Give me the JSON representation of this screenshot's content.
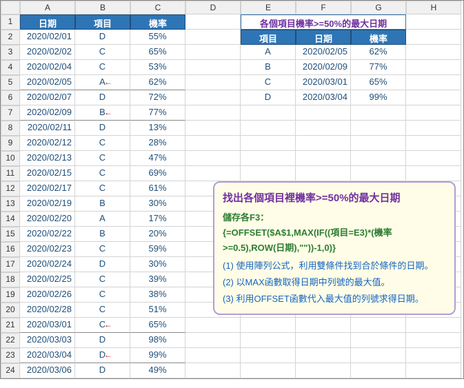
{
  "columns": [
    "A",
    "B",
    "C",
    "D",
    "E",
    "F",
    "G",
    "H"
  ],
  "rows_count": 24,
  "main_headers": {
    "date": "日期",
    "item": "項目",
    "rate": "機率"
  },
  "main": [
    {
      "date": "2020/02/01",
      "item": "D",
      "rate": "55%",
      "arrow": false,
      "ul": false
    },
    {
      "date": "2020/02/02",
      "item": "C",
      "rate": "65%",
      "arrow": false,
      "ul": false
    },
    {
      "date": "2020/02/04",
      "item": "C",
      "rate": "53%",
      "arrow": false,
      "ul": false
    },
    {
      "date": "2020/02/05",
      "item": "A",
      "rate": "62%",
      "arrow": true,
      "ul": true
    },
    {
      "date": "2020/02/07",
      "item": "D",
      "rate": "72%",
      "arrow": false,
      "ul": false
    },
    {
      "date": "2020/02/09",
      "item": "B",
      "rate": "77%",
      "arrow": true,
      "ul": true
    },
    {
      "date": "2020/02/11",
      "item": "D",
      "rate": "13%",
      "arrow": false,
      "ul": false
    },
    {
      "date": "2020/02/12",
      "item": "C",
      "rate": "28%",
      "arrow": false,
      "ul": false
    },
    {
      "date": "2020/02/13",
      "item": "C",
      "rate": "47%",
      "arrow": false,
      "ul": false
    },
    {
      "date": "2020/02/15",
      "item": "C",
      "rate": "69%",
      "arrow": false,
      "ul": false
    },
    {
      "date": "2020/02/17",
      "item": "C",
      "rate": "61%",
      "arrow": false,
      "ul": false
    },
    {
      "date": "2020/02/19",
      "item": "B",
      "rate": "30%",
      "arrow": false,
      "ul": false
    },
    {
      "date": "2020/02/20",
      "item": "A",
      "rate": "17%",
      "arrow": false,
      "ul": false
    },
    {
      "date": "2020/02/22",
      "item": "B",
      "rate": "20%",
      "arrow": false,
      "ul": false
    },
    {
      "date": "2020/02/23",
      "item": "C",
      "rate": "59%",
      "arrow": false,
      "ul": false
    },
    {
      "date": "2020/02/24",
      "item": "D",
      "rate": "30%",
      "arrow": false,
      "ul": false
    },
    {
      "date": "2020/02/25",
      "item": "C",
      "rate": "39%",
      "arrow": false,
      "ul": false
    },
    {
      "date": "2020/02/26",
      "item": "C",
      "rate": "38%",
      "arrow": false,
      "ul": false
    },
    {
      "date": "2020/02/28",
      "item": "C",
      "rate": "51%",
      "arrow": false,
      "ul": false
    },
    {
      "date": "2020/03/01",
      "item": "C",
      "rate": "65%",
      "arrow": true,
      "ul": true
    },
    {
      "date": "2020/03/03",
      "item": "D",
      "rate": "98%",
      "arrow": false,
      "ul": false
    },
    {
      "date": "2020/03/04",
      "item": "D",
      "rate": "99%",
      "arrow": true,
      "ul": true
    },
    {
      "date": "2020/03/06",
      "item": "D",
      "rate": "49%",
      "arrow": false,
      "ul": false
    }
  ],
  "side_title": "各個項目機率>=50%的最大日期",
  "side_headers": {
    "item": "項目",
    "date": "日期",
    "rate": "機率"
  },
  "side": [
    {
      "item": "A",
      "date": "2020/02/05",
      "rate": "62%"
    },
    {
      "item": "B",
      "date": "2020/02/09",
      "rate": "77%"
    },
    {
      "item": "C",
      "date": "2020/03/01",
      "rate": "65%"
    },
    {
      "item": "D",
      "date": "2020/03/04",
      "rate": "99%"
    }
  ],
  "annotation": {
    "title": "找出各個項目裡機率>=50%的最大日期",
    "sub1": "儲存各F3：",
    "sub2": "{=OFFSET($A$1,MAX(IF((項目=E3)*(機率>=0.5),ROW(日期),\"\"))-1,0)}",
    "step1": "(1) 使用陣列公式，利用雙條件找到合於條件的日期。",
    "step2": "(2) 以MAX函數取得日期中列號的最大值。",
    "step3": "(3) 利用OFFSET函數代入最大值的列號求得日期。"
  }
}
